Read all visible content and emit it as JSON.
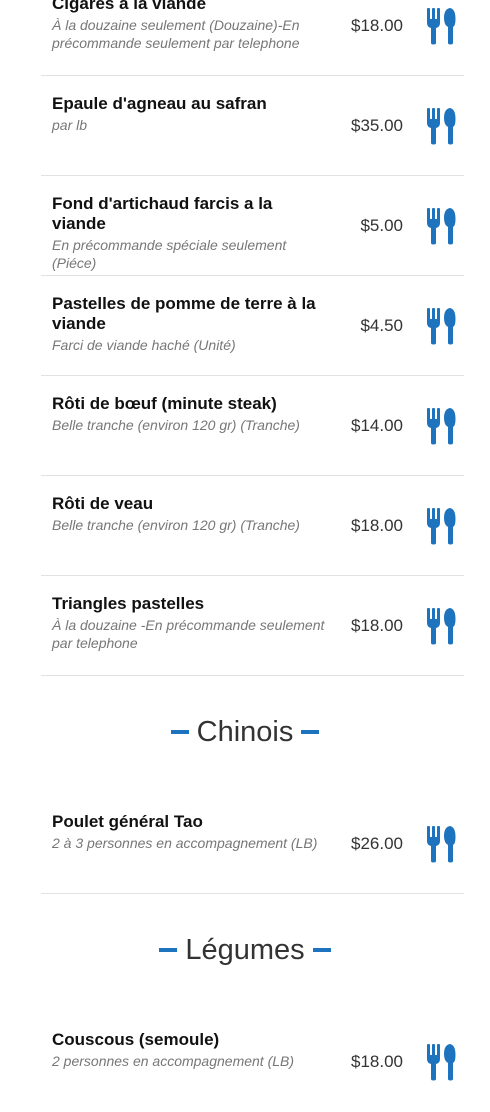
{
  "accent_color": "#1e73be",
  "icon": "fork-knife-icon",
  "items_top": [
    {
      "name": "Cigares à la viande",
      "desc": "À la douzaine seulement (Douzaine)-En précommande seulement par telephone",
      "price": "$18.00"
    },
    {
      "name": "Epaule d'agneau au safran",
      "desc": "par lb",
      "price": "$35.00"
    },
    {
      "name": "Fond d'artichaud farcis a la viande",
      "desc": "En précommande spéciale seulement (Piéce)",
      "price": "$5.00"
    },
    {
      "name": "Pastelles de pomme de terre à la viande",
      "desc": "Farci de viande haché (Unité)",
      "price": "$4.50"
    },
    {
      "name": "Rôti de bœuf (minute steak)",
      "desc": "Belle tranche (environ 120 gr) (Tranche)",
      "price": "$14.00"
    },
    {
      "name": "Rôti de veau",
      "desc": "Belle tranche (environ 120 gr) (Tranche)",
      "price": "$18.00"
    },
    {
      "name": "Triangles pastelles",
      "desc": "À la douzaine -En précommande seulement par telephone",
      "price": "$18.00"
    }
  ],
  "section_chinois": {
    "title": "Chinois",
    "items": [
      {
        "name": "Poulet général Tao",
        "desc": "2 à 3 personnes en accompagnement (LB)",
        "price": "$26.00"
      }
    ]
  },
  "section_legumes": {
    "title": "Légumes",
    "items": [
      {
        "name": "Couscous (semoule)",
        "desc": "2 personnes en accompagnement (LB)",
        "price": "$18.00"
      }
    ]
  }
}
